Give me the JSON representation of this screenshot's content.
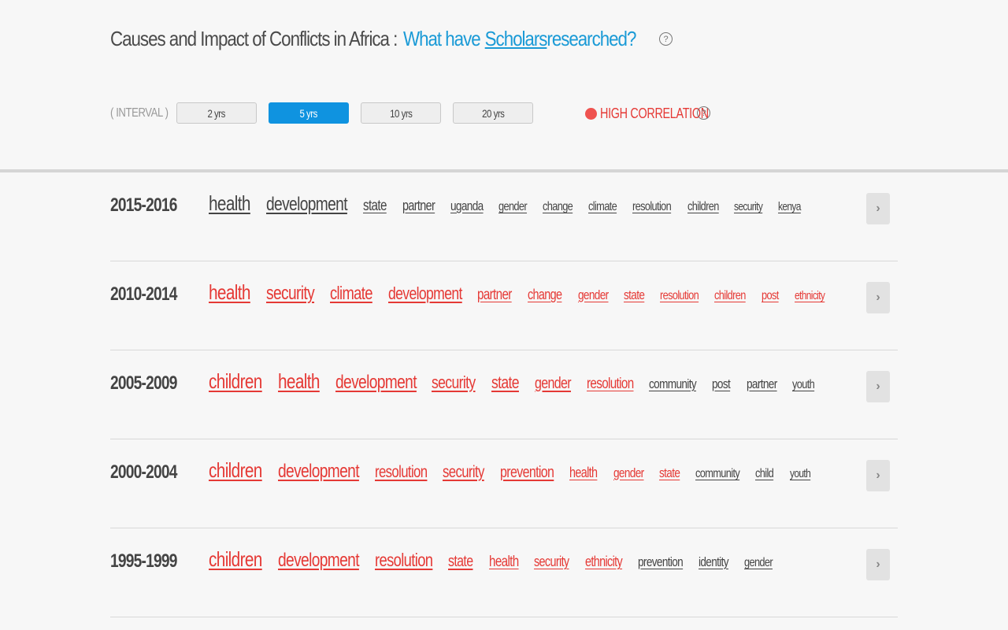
{
  "header": {
    "title_main": "Causes and Impact of Conflicts in Africa :",
    "title_q1": "What have",
    "title_link": "Scholars ",
    "title_q2": "researched?",
    "help_glyph": "?"
  },
  "interval": {
    "label": "( INTERVAL )",
    "options": [
      "2 yrs",
      "5 yrs",
      "10 yrs",
      "20 yrs"
    ],
    "selected": "5 yrs"
  },
  "legend": {
    "high_correlation": "HIGH CORRELATION",
    "color": "#ef5350"
  },
  "rows": [
    {
      "period": "2015-2016",
      "terms": [
        {
          "t": "health",
          "s": 26,
          "hi": false
        },
        {
          "t": "development",
          "s": 24,
          "hi": false
        },
        {
          "t": "state",
          "s": 19,
          "hi": false
        },
        {
          "t": "partner",
          "s": 18,
          "hi": false
        },
        {
          "t": "uganda",
          "s": 17,
          "hi": false
        },
        {
          "t": "gender",
          "s": 16,
          "hi": false
        },
        {
          "t": "change",
          "s": 16,
          "hi": false
        },
        {
          "t": "climate",
          "s": 16,
          "hi": false
        },
        {
          "t": "resolution",
          "s": 16,
          "hi": false
        },
        {
          "t": "children",
          "s": 16,
          "hi": false
        },
        {
          "t": "security",
          "s": 15,
          "hi": false
        },
        {
          "t": "kenya",
          "s": 15,
          "hi": false
        }
      ]
    },
    {
      "period": "2010-2014",
      "terms": [
        {
          "t": "health",
          "s": 26,
          "hi": true
        },
        {
          "t": "security",
          "s": 24,
          "hi": true
        },
        {
          "t": "climate",
          "s": 23,
          "hi": true
        },
        {
          "t": "development",
          "s": 22,
          "hi": true
        },
        {
          "t": "partner",
          "s": 19,
          "hi": true
        },
        {
          "t": "change",
          "s": 18,
          "hi": true
        },
        {
          "t": "gender",
          "s": 17,
          "hi": true
        },
        {
          "t": "state",
          "s": 17,
          "hi": true
        },
        {
          "t": "resolution",
          "s": 16,
          "hi": true
        },
        {
          "t": "children",
          "s": 16,
          "hi": true
        },
        {
          "t": "post",
          "s": 16,
          "hi": true
        },
        {
          "t": "ethnicity",
          "s": 15,
          "hi": true
        }
      ]
    },
    {
      "period": "2005-2009",
      "terms": [
        {
          "t": "children",
          "s": 26,
          "hi": true
        },
        {
          "t": "health",
          "s": 26,
          "hi": true
        },
        {
          "t": "development",
          "s": 24,
          "hi": true
        },
        {
          "t": "security",
          "s": 22,
          "hi": true
        },
        {
          "t": "state",
          "s": 22,
          "hi": true
        },
        {
          "t": "gender",
          "s": 20,
          "hi": true
        },
        {
          "t": "resolution",
          "s": 19,
          "hi": true
        },
        {
          "t": "community",
          "s": 17,
          "hi": false
        },
        {
          "t": "post",
          "s": 17,
          "hi": false
        },
        {
          "t": "partner",
          "s": 17,
          "hi": false
        },
        {
          "t": "youth",
          "s": 16,
          "hi": false
        }
      ]
    },
    {
      "period": "2000-2004",
      "terms": [
        {
          "t": "children",
          "s": 26,
          "hi": true
        },
        {
          "t": "development",
          "s": 24,
          "hi": true
        },
        {
          "t": "resolution",
          "s": 21,
          "hi": true
        },
        {
          "t": "security",
          "s": 21,
          "hi": true
        },
        {
          "t": "prevention",
          "s": 20,
          "hi": true
        },
        {
          "t": "health",
          "s": 18,
          "hi": true
        },
        {
          "t": "gender",
          "s": 17,
          "hi": true
        },
        {
          "t": "state",
          "s": 17,
          "hi": true
        },
        {
          "t": "community",
          "s": 16,
          "hi": false
        },
        {
          "t": "child",
          "s": 16,
          "hi": false
        },
        {
          "t": "youth",
          "s": 15,
          "hi": false
        }
      ]
    },
    {
      "period": "1995-1999",
      "terms": [
        {
          "t": "children",
          "s": 26,
          "hi": true
        },
        {
          "t": "development",
          "s": 24,
          "hi": true
        },
        {
          "t": "resolution",
          "s": 23,
          "hi": true
        },
        {
          "t": "state",
          "s": 20,
          "hi": true
        },
        {
          "t": "health",
          "s": 19,
          "hi": true
        },
        {
          "t": "security",
          "s": 18,
          "hi": true
        },
        {
          "t": "ethnicity",
          "s": 18,
          "hi": true
        },
        {
          "t": "prevention",
          "s": 17,
          "hi": false
        },
        {
          "t": "identity",
          "s": 17,
          "hi": false
        },
        {
          "t": "gender",
          "s": 16,
          "hi": false
        }
      ]
    }
  ],
  "next_glyph": "›"
}
